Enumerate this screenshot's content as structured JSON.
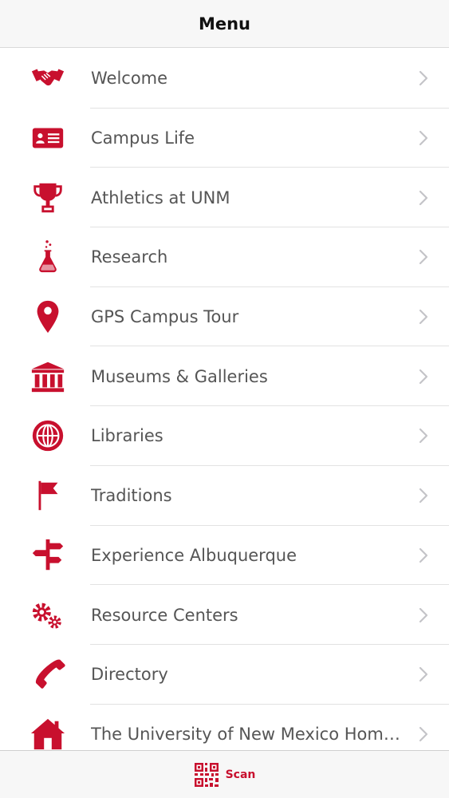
{
  "header": {
    "title": "Menu"
  },
  "colors": {
    "accent": "#c8102e",
    "label": "#555555",
    "chevron": "#c4c4c8"
  },
  "menu": {
    "items": [
      {
        "label": "Welcome",
        "icon": "handshake-icon"
      },
      {
        "label": "Campus Life",
        "icon": "id-card-icon"
      },
      {
        "label": "Athletics at UNM",
        "icon": "trophy-icon"
      },
      {
        "label": "Research",
        "icon": "flask-icon"
      },
      {
        "label": "GPS Campus Tour",
        "icon": "map-pin-icon"
      },
      {
        "label": "Museums & Galleries",
        "icon": "museum-icon"
      },
      {
        "label": "Libraries",
        "icon": "globe-icon"
      },
      {
        "label": "Traditions",
        "icon": "flag-icon"
      },
      {
        "label": "Experience Albuquerque",
        "icon": "signpost-icon"
      },
      {
        "label": "Resource Centers",
        "icon": "gears-icon"
      },
      {
        "label": "Directory",
        "icon": "phone-icon"
      },
      {
        "label": "The University of New Mexico Home...",
        "icon": "home-icon"
      }
    ]
  },
  "tabbar": {
    "scan_label": "Scan",
    "scan_icon": "qr-code-icon"
  }
}
